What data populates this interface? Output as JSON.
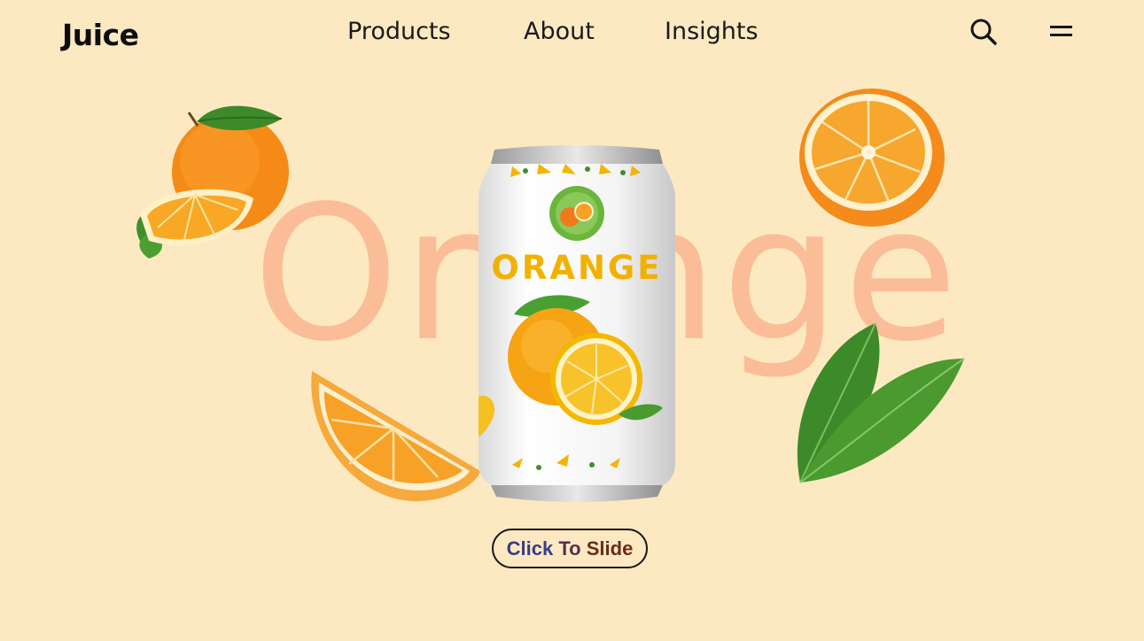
{
  "header": {
    "logo": "Juice",
    "nav": [
      {
        "label": "Products"
      },
      {
        "label": "About"
      },
      {
        "label": "Insights"
      }
    ],
    "icons": [
      "search-icon",
      "menu-icon"
    ]
  },
  "hero": {
    "background_word": "Orange",
    "can_label": "ORANGE",
    "cta": {
      "word1": "Click",
      "word2": "To",
      "word3": "Slide"
    }
  },
  "colors": {
    "background": "#fde9c1",
    "background_word": "#fbbd98",
    "orange": "#f7931e",
    "leaf": "#3f8f2a",
    "can_text": "#f4b400"
  }
}
